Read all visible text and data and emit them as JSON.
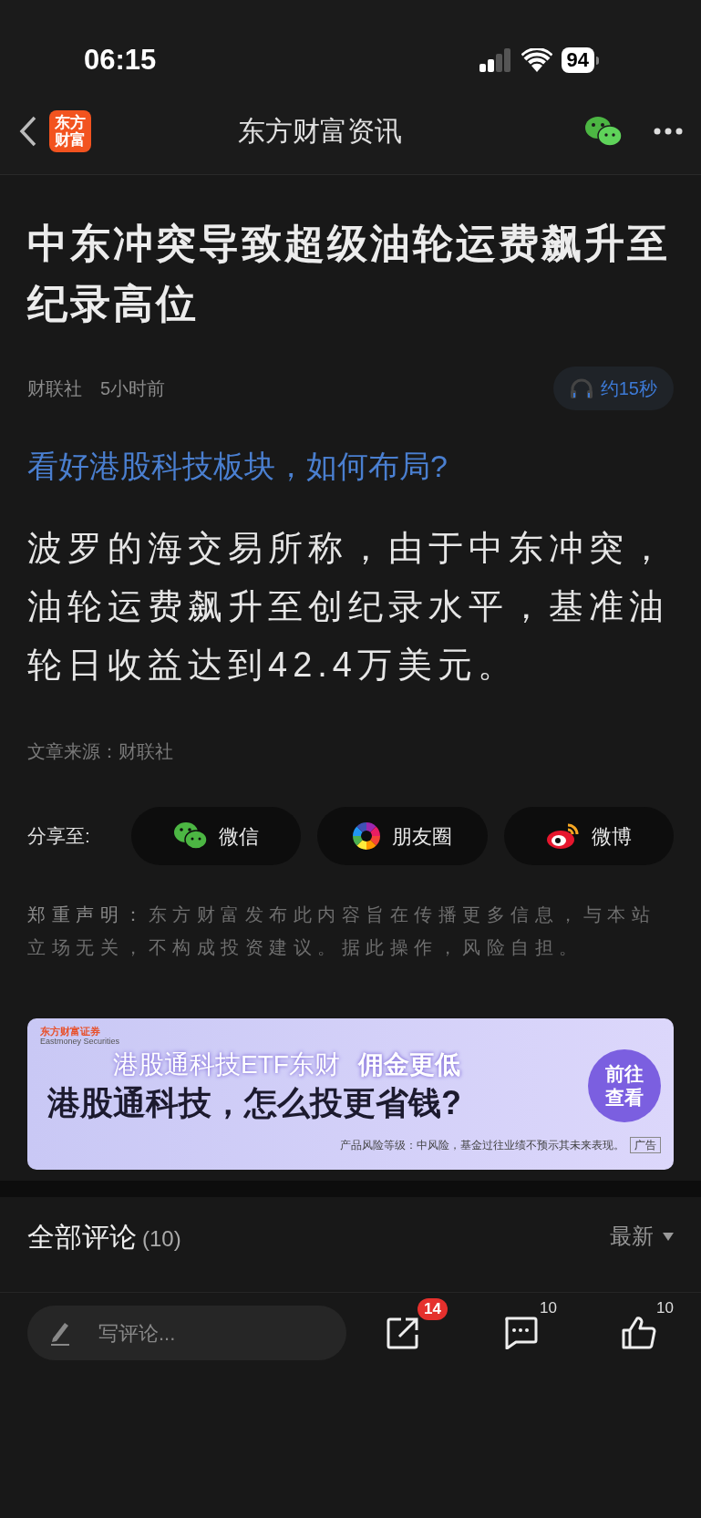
{
  "status_bar": {
    "time": "06:15",
    "battery": "94"
  },
  "nav": {
    "logo": [
      "东方",
      "财富"
    ],
    "title": "东方财富资讯"
  },
  "article": {
    "title": "中东冲突导致超级油轮运费飙升至纪录高位",
    "source": "财联社",
    "time": "5小时前",
    "audio": "约15秒",
    "promo_link": "看好港股科技板块，如何布局?",
    "body": "波罗的海交易所称，由于中东冲突，油轮运费飙升至创纪录水平，基准油轮日收益达到42.4万美元。",
    "source_line": "文章来源：财联社"
  },
  "share": {
    "label": "分享至:",
    "items": [
      {
        "kind": "wechat",
        "label": "微信"
      },
      {
        "kind": "moments",
        "label": "朋友圈"
      },
      {
        "kind": "weibo",
        "label": "微博"
      }
    ]
  },
  "disclaimer": {
    "label": "郑重声明：",
    "text": "东方财富发布此内容旨在传播更多信息，与本站立场无关，不构成投资建议。据此操作，风险自担。"
  },
  "ad": {
    "brand": "东方财富证券",
    "brand_en": "Eastmoney Securities",
    "headline": "港股通科技ETF东财",
    "highlight": "佣金更低",
    "slogan": "港股通科技，怎么投更省钱?",
    "cta": [
      "前往",
      "查看"
    ],
    "risk_note": "产品风险等级：中风险，基金过往业绩不预示其未来表现。",
    "tag": "广告"
  },
  "comments": {
    "title": "全部评论",
    "count": "(10)",
    "sort": "最新"
  },
  "bottom_bar": {
    "placeholder": "写评论...",
    "share_badge": "14",
    "comment_count": "10",
    "like_count": "10"
  }
}
